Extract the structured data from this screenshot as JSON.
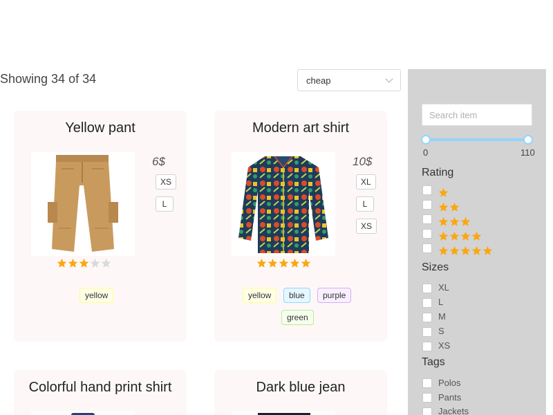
{
  "listing": {
    "showing_text": "Showing 34 of 34",
    "sort_value": "cheap"
  },
  "products": [
    {
      "title": "Yellow pant",
      "price": "6$",
      "sizes": [
        "XS",
        "L"
      ],
      "rating": 3,
      "max_rating": 5,
      "tags": [
        "yellow"
      ]
    },
    {
      "title": "Modern art shirt",
      "price": "10$",
      "sizes": [
        "XL",
        "L",
        "XS"
      ],
      "rating": 5,
      "max_rating": 5,
      "tags": [
        "yellow",
        "blue",
        "purple",
        "green"
      ]
    },
    {
      "title": "Colorful hand print shirt"
    },
    {
      "title": "Dark blue jean"
    }
  ],
  "sidebar": {
    "search_placeholder": "Search item",
    "price_min": "0",
    "price_max": "110",
    "rating_title": "Rating",
    "rating_options": [
      1,
      2,
      3,
      4,
      5
    ],
    "sizes_title": "Sizes",
    "sizes": [
      "XL",
      "L",
      "M",
      "S",
      "XS"
    ],
    "tags_title": "Tags",
    "tags": [
      "Polos",
      "Pants",
      "Jackets"
    ]
  },
  "colors": {
    "star_filled": "#faa711",
    "star_empty": "#d9d9d9",
    "tag_yellow_bg": "#feffe6",
    "tag_yellow_border": "#fffb8f",
    "tag_blue_bg": "#e6f7ff",
    "tag_blue_border": "#91d5ff",
    "tag_purple_bg": "#f9f0ff",
    "tag_purple_border": "#d3adf7",
    "tag_green_bg": "#f6ffed",
    "tag_green_border": "#b7eb8f",
    "sidebar_bg": "#d3d3d3",
    "card_bg": "#fdf8f7"
  }
}
